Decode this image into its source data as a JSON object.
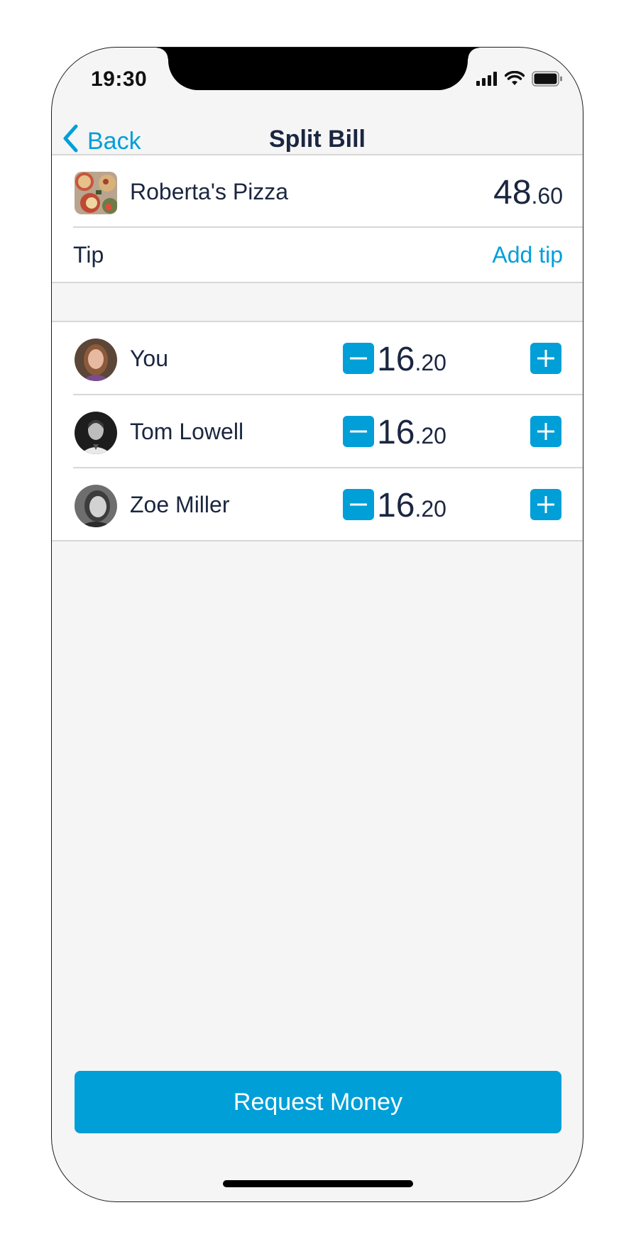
{
  "status_bar": {
    "time": "19:30",
    "icons": [
      "cellular-signal-icon",
      "wifi-icon",
      "battery-icon"
    ]
  },
  "nav": {
    "back_label": "Back",
    "title": "Split Bill"
  },
  "bill": {
    "merchant": "Roberta's Pizza",
    "amount_whole": "48",
    "amount_cents": ".60"
  },
  "tip": {
    "label": "Tip",
    "action": "Add tip"
  },
  "participants": [
    {
      "name": "You",
      "amount_whole": "16",
      "amount_cents": ".20"
    },
    {
      "name": "Tom Lowell",
      "amount_whole": "16",
      "amount_cents": ".20"
    },
    {
      "name": "Zoe Miller",
      "amount_whole": "16",
      "amount_cents": ".20"
    }
  ],
  "footer": {
    "request_label": "Request Money"
  },
  "colors": {
    "accent": "#009fd8",
    "text": "#1b2640",
    "background": "#f5f5f5"
  }
}
